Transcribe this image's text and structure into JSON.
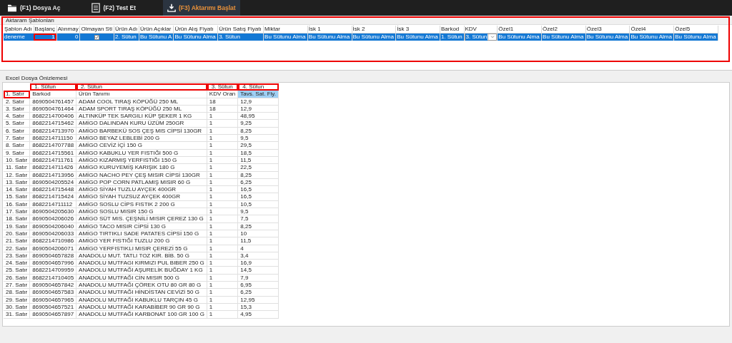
{
  "toolbar": [
    {
      "label": "(F1) Dosya Aç",
      "selected": false
    },
    {
      "label": "(F2) Test Et",
      "selected": false
    },
    {
      "label": "(F3) Aktarımı Başlat",
      "selected": true
    }
  ],
  "templates": {
    "title": "Aktaram Şablonları",
    "highlighted": true,
    "columns": [
      "Şablon Adı",
      "Başlanç",
      "Alınmay",
      "Olmayan Sti",
      "Ürün Adı",
      "Ürün Açıklar",
      "Ürün Alış Fiyatı",
      "Ürün Satış Fiyatı",
      "Miktar",
      "İsk 1",
      "İsk 2",
      "İsk 3",
      "Barkod",
      "KDV",
      "Özel1",
      "Özel2",
      "Özel3",
      "Özel4",
      "Özel5"
    ],
    "rows": [
      {
        "selected": true,
        "cells": [
          {
            "kind": "text",
            "value": "deneme"
          },
          {
            "kind": "number",
            "value": "1",
            "highlighted": true
          },
          {
            "kind": "number",
            "value": "0"
          },
          {
            "kind": "check",
            "checked": true
          },
          {
            "kind": "text",
            "value": "2. Sütun"
          },
          {
            "kind": "text",
            "value": "Bu Sütunu A"
          },
          {
            "kind": "text",
            "value": "Bu Sütunu Alma"
          },
          {
            "kind": "text",
            "value": "3. Sütun"
          },
          {
            "kind": "text",
            "value": "Bu Sütunu Alma"
          },
          {
            "kind": "text",
            "value": "Bu Sütunu Alma"
          },
          {
            "kind": "text",
            "value": "Bu Sütunu Alma"
          },
          {
            "kind": "text",
            "value": "Bu Sütunu Alma"
          },
          {
            "kind": "text",
            "value": "1. Sütun"
          },
          {
            "kind": "dropdown",
            "value": "3. Sütun"
          },
          {
            "kind": "text",
            "value": "Bu Sütunu Alma"
          },
          {
            "kind": "text",
            "value": "Bu Sütunu Alma"
          },
          {
            "kind": "text",
            "value": "Bu Sütunu Alma"
          },
          {
            "kind": "text",
            "value": "Bu Sütunu Alma"
          },
          {
            "kind": "text",
            "value": "Bu Sütunu Alma"
          }
        ]
      }
    ]
  },
  "preview": {
    "title": "Excel Dosya Önizlemesi",
    "columns": [
      {
        "label": "1. Sütun",
        "highlighted": true
      },
      {
        "label": "2. Sütun",
        "highlighted": true
      },
      {
        "label": "3. Sütun",
        "highlighted": true
      },
      {
        "label": "4. Sütun",
        "highlighted": true
      }
    ],
    "rows": [
      {
        "label": "1. Satır",
        "highlighted": true,
        "cells": [
          "Barkod",
          "Ürün Tanımı",
          "KDV Oran",
          "Tavs. Sat. Fiy."
        ],
        "selected": true
      },
      {
        "label": "2. Satır",
        "cells": [
          "8690504761457",
          "ADAM COOL TIRAŞ KÖPÜĞÜ  250 ML",
          "18",
          "12,9"
        ]
      },
      {
        "label": "3. Satır",
        "cells": [
          "8690504761464",
          "ADAM SPORT TIRAŞ KÖPÜĞÜ  250 ML",
          "18",
          "12,9"
        ]
      },
      {
        "label": "4. Satır",
        "cells": [
          "8682214700406",
          "ALTINKÜP TEK SARGILI KÜP ŞEKER  1 KG",
          "1",
          "48,95"
        ]
      },
      {
        "label": "5. Satır",
        "cells": [
          "8682214715462",
          "AMİGO DALINDAN KURU ÜZÜM 250GR",
          "1",
          "9,25"
        ]
      },
      {
        "label": "6. Satır",
        "cells": [
          "8682214713970",
          "AMİGO BARBEKÜ SOS ÇEŞ MIS CİPSİ 130GR",
          "1",
          "8,25"
        ]
      },
      {
        "label": "7. Satır",
        "cells": [
          "8682214711150",
          "AMİGO BEYAZ LEBLEBİ 200 G",
          "1",
          "9,5"
        ]
      },
      {
        "label": "8. Satır",
        "cells": [
          "8682214707788",
          "AMİGO CEVİZ İÇİ 150 G",
          "1",
          "29,5"
        ]
      },
      {
        "label": "9. Satır",
        "cells": [
          "8682214715561",
          "AMİGO KABUKLU YER FISTIĞI 500 G",
          "1",
          "18,5"
        ]
      },
      {
        "label": "10. Satır",
        "cells": [
          "8682214711761",
          "AMİGO KIZARMIŞ YERFISTIĞI  150 G",
          "1",
          "11,5"
        ]
      },
      {
        "label": "11. Satır",
        "cells": [
          "8682214711426",
          "AMİGO KURUYEMİŞ KARIŞIK 180 G",
          "1",
          "22,5"
        ]
      },
      {
        "label": "12. Satır",
        "cells": [
          "8682214713956",
          "AMİGO NACHO PEY ÇEŞ MISIR CİPSİ 130GR",
          "1",
          "8,25"
        ]
      },
      {
        "label": "13. Satır",
        "cells": [
          "8690504205524",
          "AMİGO POP CORN PATLAMIŞ MISIR 60 G",
          "1",
          "6,25"
        ]
      },
      {
        "label": "14. Satır",
        "cells": [
          "8682214715448",
          "AMİGO SİYAH TUZLU AYÇEK 400GR",
          "1",
          "16,5"
        ]
      },
      {
        "label": "15. Satır",
        "cells": [
          "8682214715424",
          "AMİGO SİYAH TUZSUZ AYÇEK 400GR",
          "1",
          "16,5"
        ]
      },
      {
        "label": "16. Satır",
        "cells": [
          "8682214711112",
          "AMİGO SOSLU CİPS FISTIK 2 200 G",
          "1",
          "10,5"
        ]
      },
      {
        "label": "17. Satır",
        "cells": [
          "8690504205630",
          "AMİGO SOSLU MISIR 150 G",
          "1",
          "9,5"
        ]
      },
      {
        "label": "18. Satır",
        "cells": [
          "8690504206026",
          "AMİGO SÜT MIS. ÇEŞNİLİ MISIR ÇEREZ 130 G",
          "1",
          "7,5"
        ]
      },
      {
        "label": "19. Satır",
        "cells": [
          "8690504206040",
          "AMİGO TACO MISIR CİPSİ 130 G",
          "1",
          "8,25"
        ]
      },
      {
        "label": "20. Satır",
        "cells": [
          "8690504206033",
          "AMİGO TIRTIKLI SADE PATATES CİPSİ  150 G",
          "1",
          "10"
        ]
      },
      {
        "label": "21. Satır",
        "cells": [
          "8682214710986",
          "AMİGO YER FISTIĞI TUZLU 200 G",
          "1",
          "11,5"
        ]
      },
      {
        "label": "22. Satır",
        "cells": [
          "8690504206071",
          "AMİGO YERFISTIKLI MISIR ÇEREZİ 55 G",
          "1",
          "4"
        ]
      },
      {
        "label": "23. Satır",
        "cells": [
          "8690504657828",
          "ANADOLU MUT. TATLI TOZ KIR. BİB. 50 G",
          "1",
          "3,4"
        ]
      },
      {
        "label": "24. Satır",
        "cells": [
          "8690504657996",
          "ANADOLU MUTFAGI KIRMIZI PUL BIBER 250 G",
          "1",
          "16,9"
        ]
      },
      {
        "label": "25. Satır",
        "cells": [
          "8682214709959",
          "ANADOLU MUTFAĞI AŞURELİK BUĞDAY  1 KG",
          "1",
          "14,5"
        ]
      },
      {
        "label": "26. Satır",
        "cells": [
          "8682214710405",
          "ANADOLU MUTFAĞI CİN MISIR  500 G",
          "1",
          "7,9"
        ]
      },
      {
        "label": "27. Satır",
        "cells": [
          "8690504657842",
          "ANADOLU MUTFAĞI ÇÖREK OTU 80 GR 80 G",
          "1",
          "6,95"
        ]
      },
      {
        "label": "28. Satır",
        "cells": [
          "8690504657583",
          "ANADOLU MUTFAĞI HİNDİSTAN CEVİZİ 50 G",
          "1",
          "6,25"
        ]
      },
      {
        "label": "29. Satır",
        "cells": [
          "8690504657965",
          "ANADOLU MUTFAĞI KABUKLU TARÇIN 45 G",
          "1",
          "12,95"
        ]
      },
      {
        "label": "30. Satır",
        "cells": [
          "8690504657521",
          "ANADOLU MUTFAĞI KARABİBER 90 GR 90 G",
          "1",
          "15,3"
        ]
      },
      {
        "label": "31. Satır",
        "cells": [
          "8690504657897",
          "ANADOLU MUTFAĞI KARBONAT 100 GR 100 G",
          "1",
          "4,95"
        ]
      }
    ]
  }
}
